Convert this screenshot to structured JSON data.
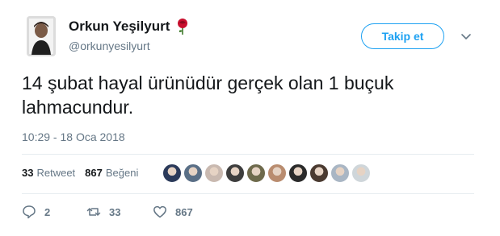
{
  "author": {
    "display_name": "Orkun Yeşilyurt",
    "handle": "@orkunyesilyurt",
    "badge_icon": "rose-icon"
  },
  "follow_button": "Takip et",
  "tweet": {
    "text": "14 şubat hayal ürünüdür gerçek olan 1 buçuk lahmacundur.",
    "timestamp": "10:29 - 18 Oca 2018"
  },
  "stats": {
    "retweet_count": "33",
    "retweet_label": "Retweet",
    "like_count": "867",
    "like_label": "Beğeni"
  },
  "liker_avatars": [
    {
      "color": "#2b3a5a"
    },
    {
      "color": "#5a6f86"
    },
    {
      "color": "#c9b9b0"
    },
    {
      "color": "#3d3d3d"
    },
    {
      "color": "#6e6a4c"
    },
    {
      "color": "#b98c6f"
    },
    {
      "color": "#2a2a2a"
    },
    {
      "color": "#4a3a30"
    },
    {
      "color": "#a9b6c4"
    },
    {
      "color": "#cfd6da"
    }
  ],
  "actions": {
    "reply_count": "2",
    "retweet_count": "33",
    "like_count": "867"
  },
  "colors": {
    "accent": "#1da1f2",
    "muted": "#657786",
    "rose": "#c8102e"
  }
}
